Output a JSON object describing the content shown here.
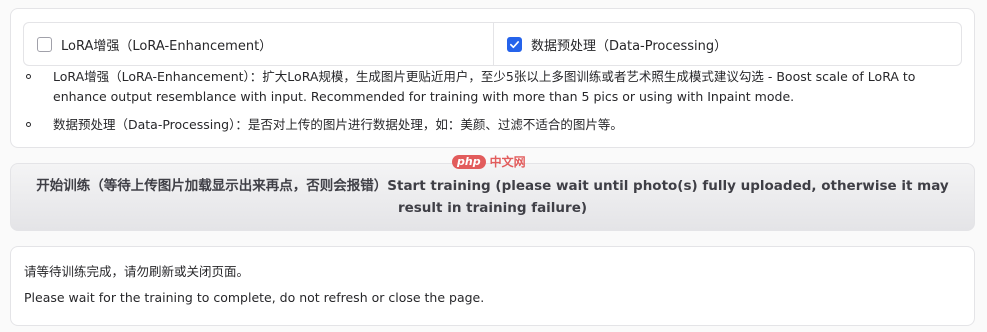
{
  "options": {
    "checkboxes": [
      {
        "label": "LoRA增强（LoRA-Enhancement）",
        "checked": false
      },
      {
        "label": "数据预处理（Data-Processing）",
        "checked": true
      }
    ],
    "descriptions": [
      "LoRA增强（LoRA-Enhancement）：扩大LoRA规模，生成图片更贴近用户，至少5张以上多图训练或者艺术照生成模式建议勾选 - Boost scale of LoRA to enhance output resemblance with input. Recommended for training with more than 5 pics or using with Inpaint mode.",
      "数据预处理（Data-Processing）：是否对上传的图片进行数据处理，如：美颜、过滤不适合的图片等。"
    ]
  },
  "start_button": {
    "label": "开始训练（等待上传图片加载显示出来再点，否则会报错）Start training (please wait until photo(s) fully uploaded, otherwise it may result in training failure)"
  },
  "status": {
    "zh": "请等待训练完成，请勿刷新或关闭页面。",
    "en": "Please wait for the training to complete, do not refresh or close the page."
  },
  "watermark": {
    "logo": "php",
    "text": "中文网"
  },
  "colors": {
    "accent": "#2563eb",
    "border": "#e4e4e7",
    "watermark": "#e25c5c"
  }
}
